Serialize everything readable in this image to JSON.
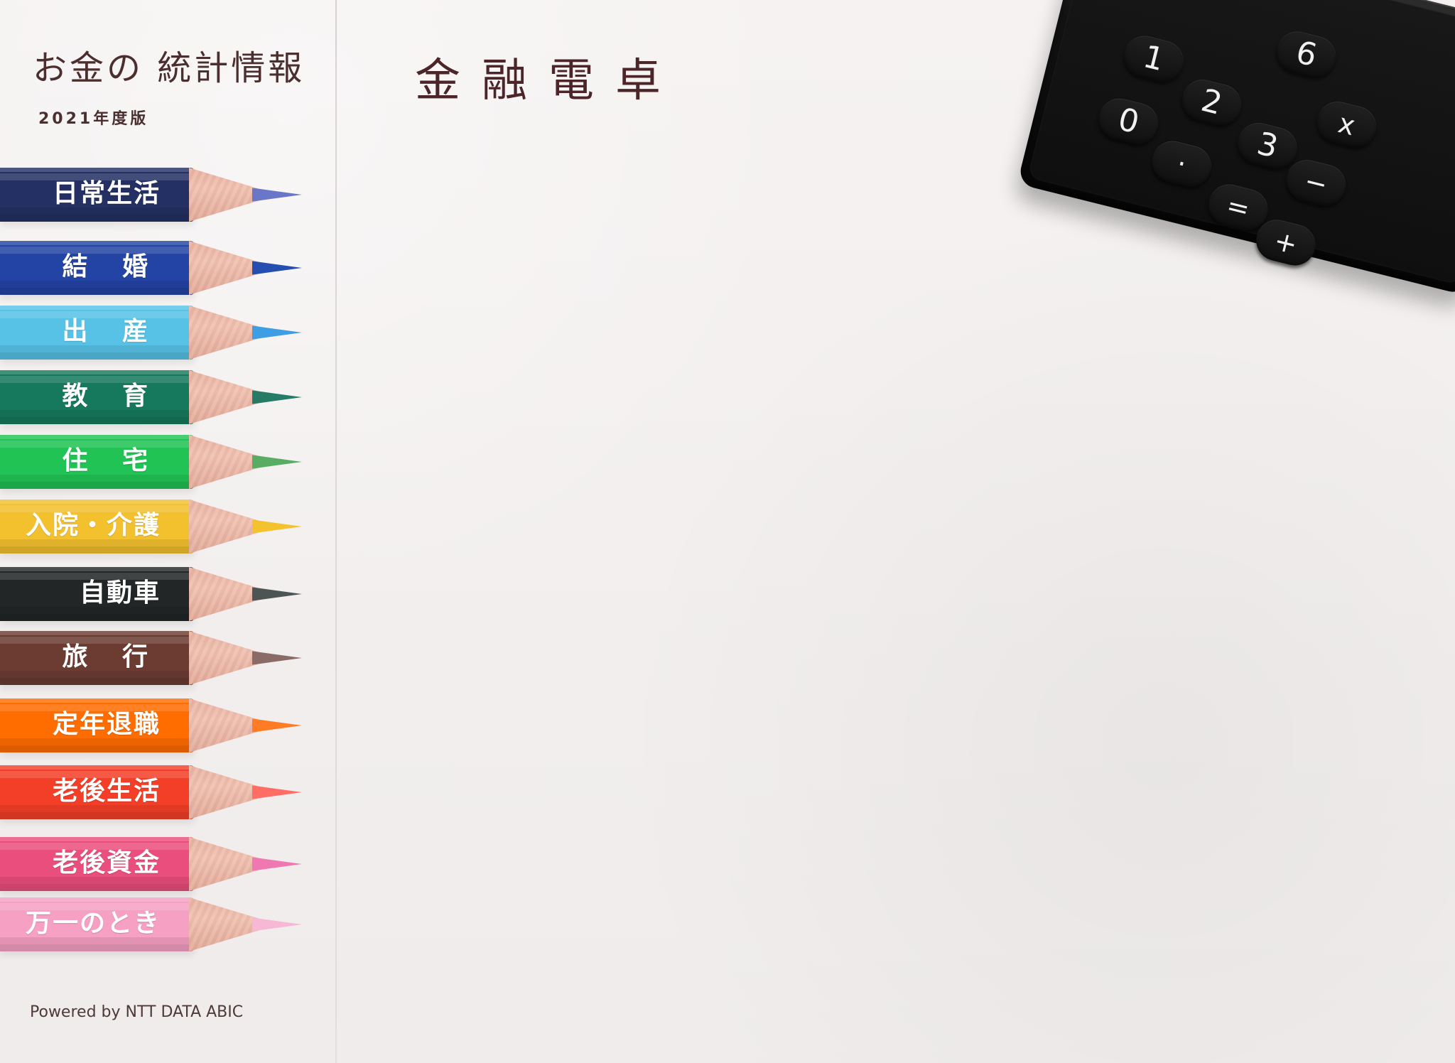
{
  "brand": {
    "title": "お金の 統計情報",
    "edition": "2021年度版"
  },
  "main": {
    "title": "金融電卓"
  },
  "sidebar": {
    "items": [
      {
        "label": "日常生活",
        "body_color": "#243063",
        "lead_color": "#6a76c8"
      },
      {
        "label": "結 婚",
        "body_color": "#2344a4",
        "lead_color": "#244fb0"
      },
      {
        "label": "出 産",
        "body_color": "#57c2e6",
        "lead_color": "#3e9ee3"
      },
      {
        "label": "教 育",
        "body_color": "#16795d",
        "lead_color": "#257b65"
      },
      {
        "label": "住 宅",
        "body_color": "#20c354",
        "lead_color": "#59ac63"
      },
      {
        "label": "入院・介護",
        "body_color": "#f3c12e",
        "lead_color": "#f4c22c"
      },
      {
        "label": "自動車",
        "body_color": "#222626",
        "lead_color": "#4d5454"
      },
      {
        "label": "旅 行",
        "body_color": "#6c3c33",
        "lead_color": "#8a6b67"
      },
      {
        "label": "定年退職",
        "body_color": "#ff6d00",
        "lead_color": "#ff7b24"
      },
      {
        "label": "老後生活",
        "body_color": "#f33f28",
        "lead_color": "#ff6d65"
      },
      {
        "label": "老後資金",
        "body_color": "#ea4e7c",
        "lead_color": "#f078b2"
      },
      {
        "label": "万一のとき",
        "body_color": "#f6a0c4",
        "lead_color": "#f6b8d5"
      }
    ]
  },
  "calculator": {
    "keys": [
      "6",
      "1",
      "2",
      "3",
      "x",
      "0",
      "·",
      "=",
      "−",
      "+"
    ]
  },
  "footer": {
    "powered_by": "Powered by NTT DATA ABIC"
  }
}
